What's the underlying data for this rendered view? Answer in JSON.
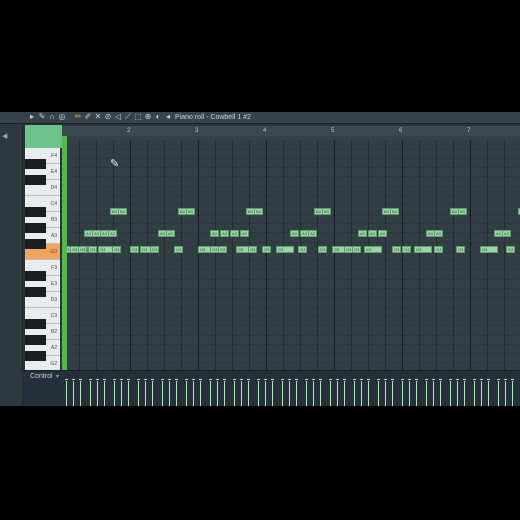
{
  "toolbar": {
    "title": "Piano roll - Cowbell 1 #2",
    "icons": [
      "arrow-icon",
      "wrench-icon",
      "magnet-icon",
      "record-icon",
      "pencil-icon",
      "brush-icon",
      "delete-icon",
      "mute-icon",
      "slice-icon",
      "select-icon",
      "zoom-icon",
      "playback-icon",
      "speaker-icon"
    ]
  },
  "ruler": {
    "bars": [
      "2",
      "3",
      "4",
      "5",
      "6",
      "7"
    ]
  },
  "keyboard": {
    "labels": [
      "F4",
      "E4",
      "D4",
      "C4",
      "B3",
      "A3",
      "G3",
      "F3",
      "E3",
      "D3",
      "C3",
      "B2",
      "A2",
      "G2"
    ]
  },
  "notes": {
    "rows": {
      "B3": [
        "B3",
        "B3",
        "B3",
        "B3",
        "B3",
        "B3",
        "B3",
        "B3",
        "B3",
        "B3",
        "B3",
        "B3",
        "B3",
        "B3"
      ],
      "A3": [
        "A3",
        "A3",
        "A3",
        "A3",
        "A3",
        "A3",
        "A3",
        "A3",
        "A3",
        "A3",
        "A3",
        "A3",
        "A3",
        "A3",
        "A3",
        "A3",
        "A3",
        "A3",
        "A3",
        "A3"
      ],
      "G3": [
        "G3",
        "G3",
        "G3",
        "G3",
        "G3",
        "G3",
        "G3",
        "G3",
        "G3",
        "G3",
        "G3",
        "G3",
        "G3",
        "G3",
        "G3",
        "G3",
        "G3",
        "G3",
        "G3",
        "G3",
        "G3",
        "G3",
        "G3",
        "G3",
        "G3",
        "G3",
        "G3",
        "G3",
        "G3",
        "G3"
      ]
    }
  },
  "control": {
    "label": "Control",
    "dropdown": "▾"
  },
  "colors": {
    "accent": "#6ec38a",
    "note": "#9ad7a6",
    "selected_key": "#f4a45a"
  }
}
